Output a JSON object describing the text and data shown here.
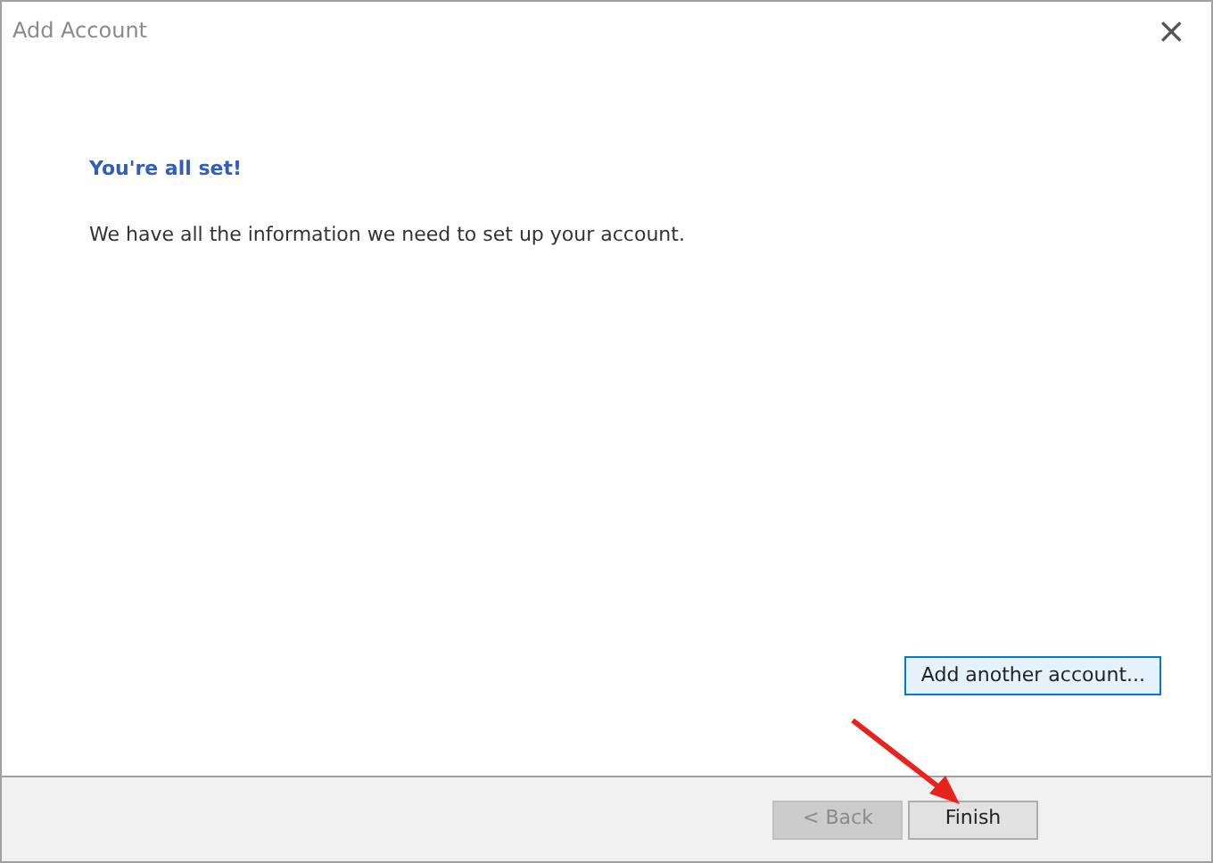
{
  "window": {
    "title": "Add Account",
    "close": "×"
  },
  "heading": "You're all set!",
  "message": "We have all the information we need to set up your account.",
  "add_button": {
    "label": "Add another account...",
    "focused": true
  },
  "footer_buttons": [
    {
      "label": "< Back",
      "disabled": true
    },
    {
      "label": "Finish",
      "disabled": false
    }
  ]
}
